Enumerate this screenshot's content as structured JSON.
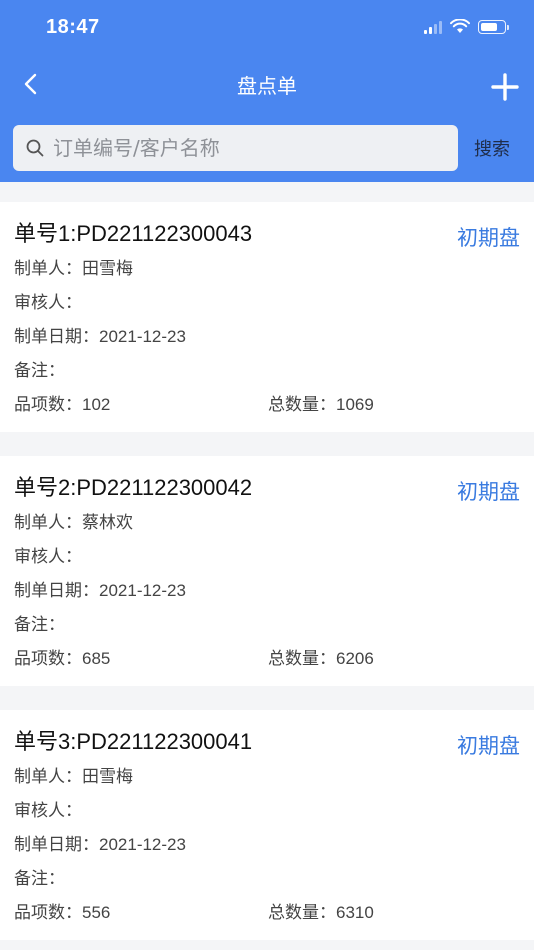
{
  "status": {
    "time": "18:47"
  },
  "nav": {
    "title": "盘点单"
  },
  "search": {
    "placeholder": "订单编号/客户名称",
    "button_label": "搜索"
  },
  "colors": {
    "primary": "#4a86f0",
    "accent": "#3a7be0"
  },
  "labels": {
    "maker": "制单人：",
    "reviewer": "审核人：",
    "date": "制单日期：",
    "remark": "备注：",
    "items": "品项数：",
    "total": "总数量："
  },
  "orders": [
    {
      "title": "单号1:PD221122300043",
      "type": "初期盘",
      "maker": "田雪梅",
      "reviewer": "",
      "date": "2021-12-23",
      "remark": "",
      "items": "102",
      "total": "1069"
    },
    {
      "title": "单号2:PD221122300042",
      "type": "初期盘",
      "maker": "蔡林欢",
      "reviewer": "",
      "date": "2021-12-23",
      "remark": "",
      "items": "685",
      "total": "6206"
    },
    {
      "title": "单号3:PD221122300041",
      "type": "初期盘",
      "maker": "田雪梅",
      "reviewer": "",
      "date": "2021-12-23",
      "remark": "",
      "items": "556",
      "total": "6310"
    }
  ]
}
